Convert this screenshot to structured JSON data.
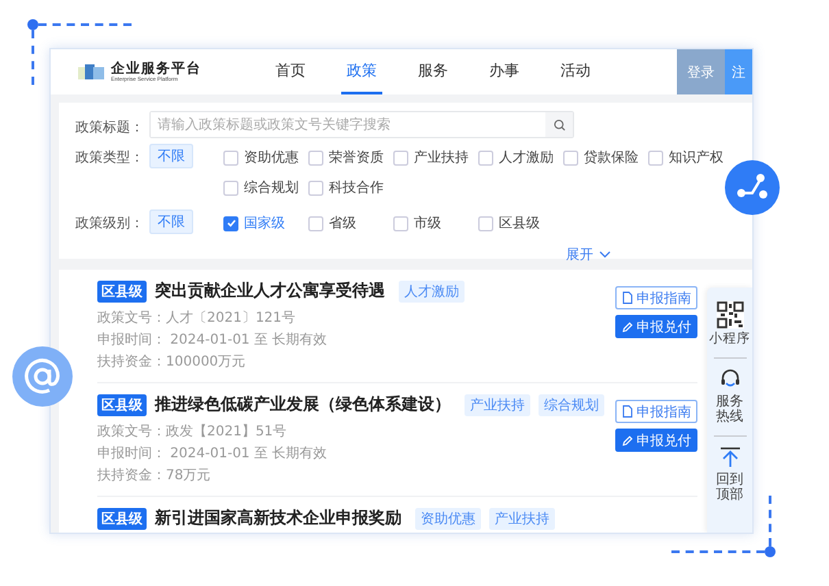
{
  "brand": {
    "name": "企业服务平台",
    "tagline": "Enterprise Service Platform"
  },
  "nav": [
    {
      "label": "首页",
      "selected": false
    },
    {
      "label": "政策",
      "selected": true
    },
    {
      "label": "服务",
      "selected": false
    },
    {
      "label": "办事",
      "selected": false
    },
    {
      "label": "活动",
      "selected": false
    }
  ],
  "auth_buttons": [
    {
      "label": "登录",
      "kind": "login"
    },
    {
      "label": "注",
      "kind": "register"
    }
  ],
  "filters": {
    "search": {
      "label": "政策标题：",
      "placeholder": "请输入政策标题或政策文号关键字搜索"
    },
    "groups": [
      {
        "label": "政策类型：",
        "any": {
          "label": "不限",
          "selected": true
        },
        "options": [
          {
            "label": "资助优惠",
            "checked": false
          },
          {
            "label": "荣誉资质",
            "checked": false
          },
          {
            "label": "产业扶持",
            "checked": false
          },
          {
            "label": "人才激励",
            "checked": false
          },
          {
            "label": "贷款保险",
            "checked": false
          },
          {
            "label": "知识产权",
            "checked": false
          },
          {
            "label": "综合规划",
            "checked": false
          },
          {
            "label": "科技合作",
            "checked": false
          }
        ]
      },
      {
        "label": "政策级别：",
        "any": {
          "label": "不限",
          "selected": true
        },
        "options": [
          {
            "label": "国家级",
            "checked": true
          },
          {
            "label": "省级",
            "checked": false
          },
          {
            "label": "市级",
            "checked": false
          },
          {
            "label": "区县级",
            "checked": false
          }
        ]
      }
    ],
    "expand": "展开"
  },
  "policies": [
    {
      "level": "区县级",
      "title": "突出贡献企业人才公寓享受待遇",
      "tags": [
        "人才激励"
      ],
      "meta": [
        "政策文号：人才〔2021〕121号",
        "申报时间： 2024-01-01 至 长期有效",
        "扶持资金：100000万元"
      ],
      "buttons": [
        {
          "label": "申报指南",
          "kind": "guide"
        },
        {
          "label": "申报兑付",
          "kind": "apply"
        }
      ]
    },
    {
      "level": "区县级",
      "title": "推进绿色低碳产业发展（绿色体系建设）",
      "tags": [
        "产业扶持",
        "综合规划"
      ],
      "meta": [
        "政策文号：政发【2021】51号",
        "申报时间： 2024-01-01 至 长期有效",
        "扶持资金：78万元"
      ],
      "buttons": [
        {
          "label": "申报指南",
          "kind": "guide"
        },
        {
          "label": "申报兑付",
          "kind": "apply"
        }
      ]
    },
    {
      "level": "区县级",
      "title": "新引进国家高新技术企业申报奖励",
      "tags": [
        "资助优惠",
        "产业扶持"
      ]
    }
  ],
  "side_toolbar": [
    {
      "kind": "qr",
      "label": "小程序"
    },
    {
      "kind": "headset",
      "label": "服务热线"
    },
    {
      "kind": "top",
      "label": "回到顶部"
    }
  ]
}
